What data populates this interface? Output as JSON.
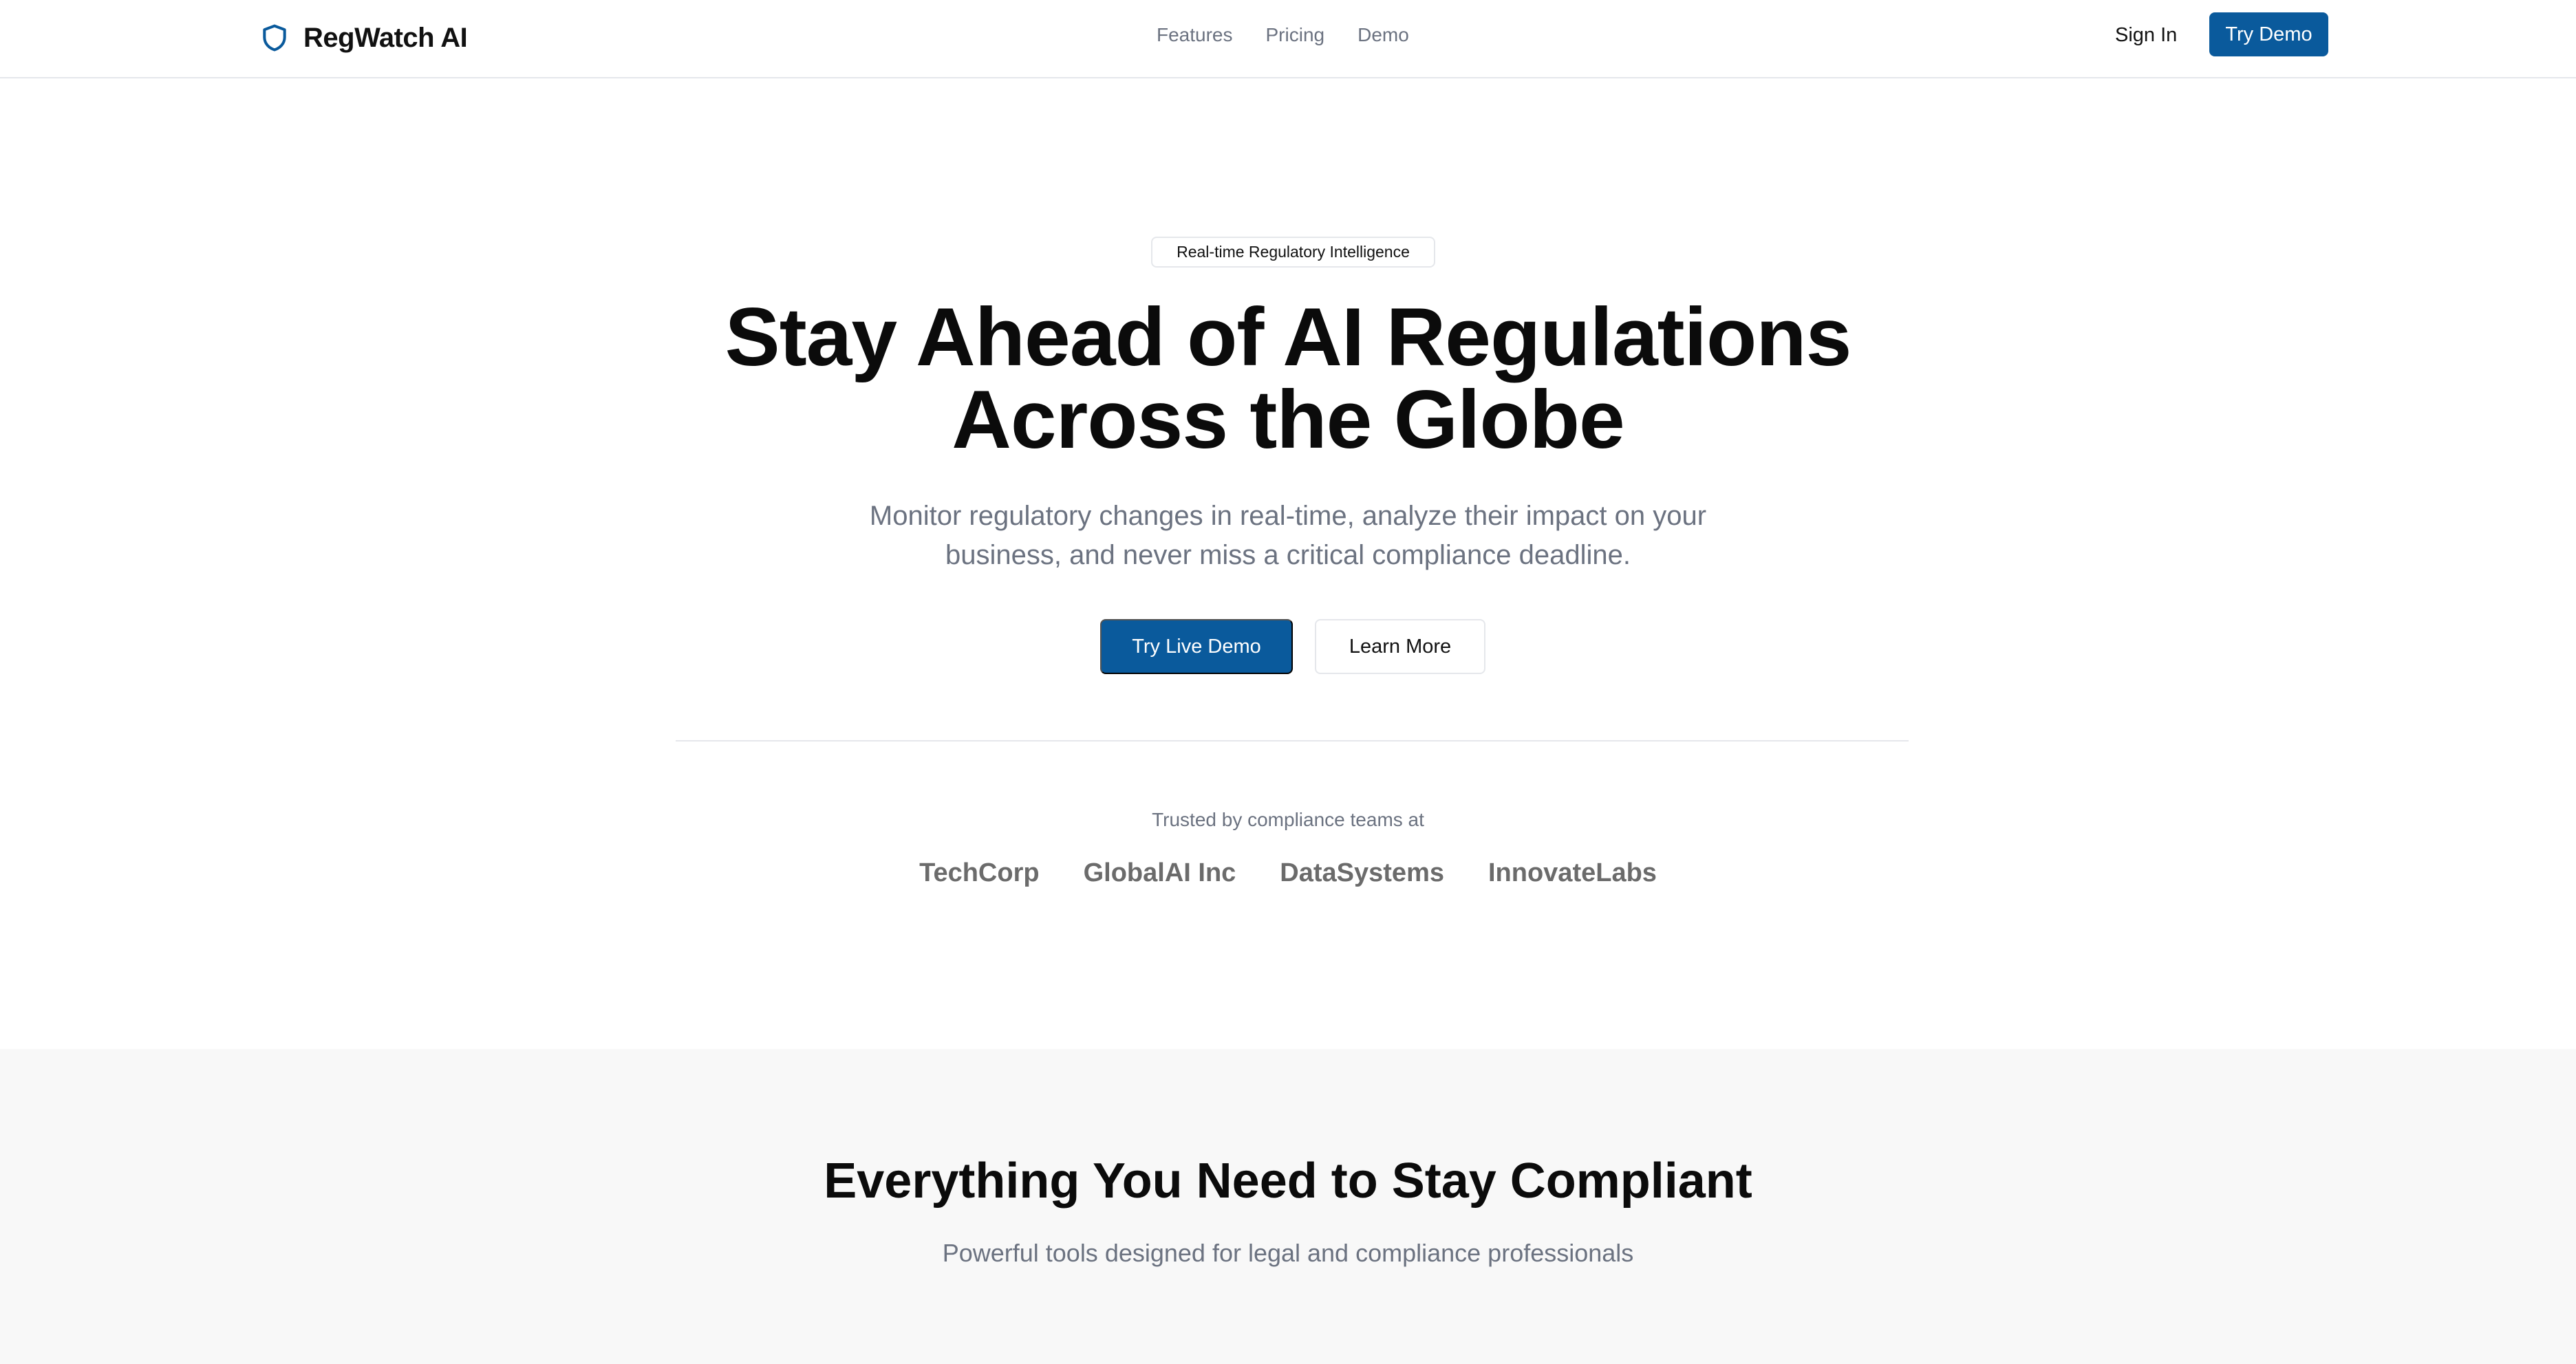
{
  "nav": {
    "brand": "RegWatch AI",
    "links": [
      "Features",
      "Pricing",
      "Demo"
    ],
    "signin": "Sign In",
    "cta": "Try Demo"
  },
  "hero": {
    "badge": "Real-time Regulatory Intelligence",
    "title_line1": "Stay Ahead of AI Regulations",
    "title_line2": "Across the Globe",
    "subtitle_line1": "Monitor regulatory changes in real-time, analyze their impact on your",
    "subtitle_line2": "business, and never miss a critical compliance deadline.",
    "primary_button": "Try Live Demo",
    "secondary_button": "Learn More"
  },
  "trusted": {
    "label": "Trusted by compliance teams at",
    "logos": [
      "TechCorp",
      "GlobalAI Inc",
      "DataSystems",
      "InnovateLabs"
    ]
  },
  "features": {
    "title": "Everything You Need to Stay Compliant",
    "subtitle": "Powerful tools designed for legal and compliance professionals"
  },
  "colors": {
    "brand": "#0a5a9c",
    "muted_text": "#6b7280",
    "border": "#e5e7eb",
    "section_bg": "#f8f8f8"
  },
  "icons": {
    "brand": "shield-icon"
  }
}
